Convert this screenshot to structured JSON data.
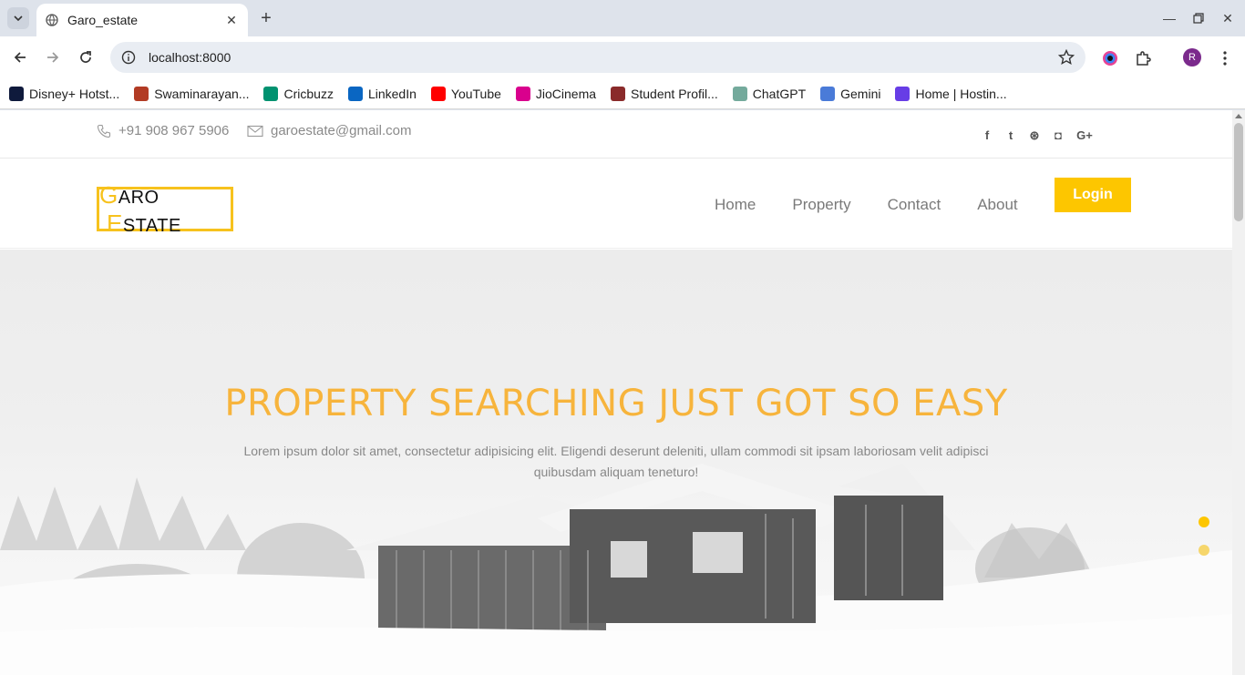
{
  "browser": {
    "tab_title": "Garo_estate",
    "url": "localhost:8000",
    "profile_initial": "R",
    "bookmarks": [
      {
        "label": "Disney+ Hotst...",
        "icon": "disney-hotstar-icon",
        "color": "#0f1a3c"
      },
      {
        "label": "Swaminarayan...",
        "icon": "swaminarayan-icon",
        "color": "#b23b24"
      },
      {
        "label": "Cricbuzz",
        "icon": "cricbuzz-icon",
        "color": "#009270"
      },
      {
        "label": "LinkedIn",
        "icon": "linkedin-icon",
        "color": "#0a66c2"
      },
      {
        "label": "YouTube",
        "icon": "youtube-icon",
        "color": "#ff0000"
      },
      {
        "label": "JioCinema",
        "icon": "jiocinema-icon",
        "color": "#d9008d"
      },
      {
        "label": "Student Profil...",
        "icon": "student-profile-icon",
        "color": "#8a2b2b"
      },
      {
        "label": "ChatGPT",
        "icon": "chatgpt-icon",
        "color": "#74aa9c"
      },
      {
        "label": "Gemini",
        "icon": "gemini-icon",
        "color": "#4a7bd8"
      },
      {
        "label": "Home | Hostin...",
        "icon": "hostinger-icon",
        "color": "#673de6"
      }
    ]
  },
  "topbar": {
    "phone": "+91 908 967 5906",
    "email": "garoestate@gmail.com",
    "socials": [
      {
        "icon": "facebook-icon",
        "glyph": "f"
      },
      {
        "icon": "twitter-icon",
        "glyph": "t"
      },
      {
        "icon": "dribbble-icon",
        "glyph": "⊛"
      },
      {
        "icon": "instagram-icon",
        "glyph": "◘"
      },
      {
        "icon": "google-plus-icon",
        "glyph": "G+"
      }
    ]
  },
  "header": {
    "logo": {
      "first_cap": "G",
      "first_rest": "ARO",
      "second_cap": "E",
      "second_rest": "STATE"
    },
    "nav": [
      "Home",
      "Property",
      "Contact",
      "About"
    ],
    "login_label": "Login"
  },
  "hero": {
    "title": "PROPERTY SEARCHING JUST GOT SO EASY",
    "subtitle": "Lorem ipsum dolor sit amet, consectetur adipisicing elit. Eligendi deserunt deleniti, ullam commodi sit ipsam laboriosam velit adipisci quibusdam aliquam teneturo!"
  },
  "colors": {
    "accent": "#fdc600",
    "title": "#f7b43c",
    "logo_border": "#f7c21d"
  }
}
